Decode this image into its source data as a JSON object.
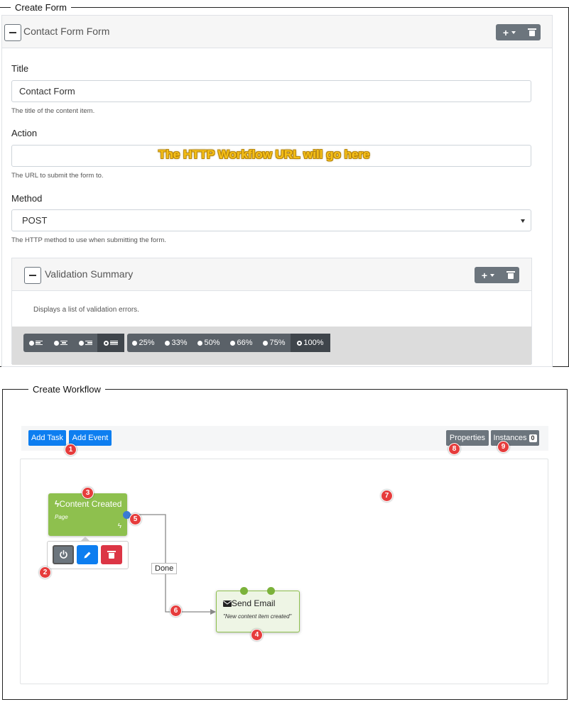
{
  "form_panel": {
    "legend": "Create Form",
    "card_title": "Contact Form Form",
    "title_field": {
      "label": "Title",
      "value": "Contact Form",
      "hint": "The title of the content item."
    },
    "action_field": {
      "label": "Action",
      "value": "",
      "overlay_note": "The HTTP Workflow URL will go here",
      "hint": "The URL to submit the form to."
    },
    "method_field": {
      "label": "Method",
      "value": "POST",
      "hint": "The HTTP method to use when submitting the form."
    },
    "validation_card": {
      "title": "Validation Summary",
      "body": "Displays a list of validation errors."
    },
    "width_options": [
      "25%",
      "33%",
      "50%",
      "66%",
      "75%",
      "100%"
    ],
    "selected_width": "100%"
  },
  "workflow_panel": {
    "legend": "Create Workflow",
    "buttons": {
      "add_task": "Add Task",
      "add_event": "Add Event",
      "properties": "Properties",
      "instances": "Instances",
      "instances_count": "0"
    },
    "trigger_node": {
      "title": "Content Created",
      "subtitle": "Page"
    },
    "task_node": {
      "title": "Send Email",
      "subtitle": "\"New content item created\""
    },
    "connector_label": "Done",
    "markers": [
      "1",
      "2",
      "3",
      "4",
      "5",
      "6",
      "7",
      "8",
      "9"
    ]
  },
  "colors": {
    "primary": "#0d7ef0",
    "secondary": "#6c757d",
    "danger": "#dc3545",
    "node_green": "#8ec04e",
    "marker_red": "#e63c3c",
    "endpoint_blue": "#3a7bd5"
  }
}
